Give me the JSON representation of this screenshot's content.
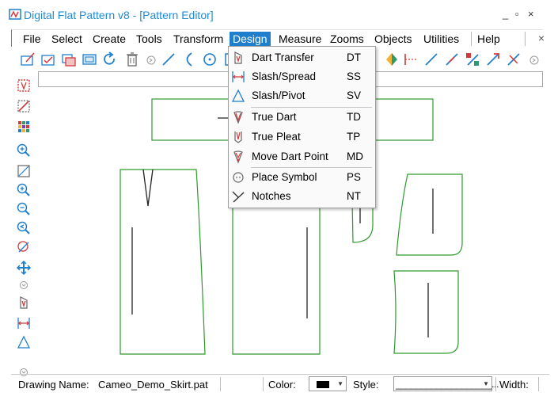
{
  "window": {
    "title": "Digital Flat Pattern v8 - [Pattern Editor]",
    "controls": [
      "_",
      "▫",
      "×"
    ]
  },
  "menubar": {
    "items": [
      "File",
      "Select",
      "Create",
      "Tools",
      "Transform",
      "Design",
      "Measure",
      "Zooms",
      "Objects",
      "Utilities",
      "Help"
    ],
    "active": "Design",
    "close_glyph": "×"
  },
  "design_menu": {
    "items": [
      {
        "label": "Dart Transfer",
        "shortcut": "DT",
        "icon": "dart-transfer-icon"
      },
      {
        "label": "Slash/Spread",
        "shortcut": "SS",
        "icon": "slash-spread-icon"
      },
      {
        "label": "Slash/Pivot",
        "shortcut": "SV",
        "icon": "slash-pivot-icon"
      },
      {
        "label": "True Dart",
        "shortcut": "TD",
        "icon": "true-dart-icon"
      },
      {
        "label": "True Pleat",
        "shortcut": "TP",
        "icon": "true-pleat-icon"
      },
      {
        "label": "Move Dart Point",
        "shortcut": "MD",
        "icon": "move-dart-point-icon"
      },
      {
        "label": "Place Symbol",
        "shortcut": "PS",
        "icon": "place-symbol-icon"
      },
      {
        "label": "Notches",
        "shortcut": "NT",
        "icon": "notches-icon"
      }
    ]
  },
  "statusbar": {
    "drawing_label": "Drawing Name:",
    "drawing_name": "Cameo_Demo_Skirt.pat",
    "color_label": "Color:",
    "color_value": "#000000",
    "style_label": "Style:",
    "style_value": "___________________...",
    "width_label": "Width:"
  },
  "colors": {
    "accent": "#1f7fcc",
    "title": "#1f8bd6",
    "pattern_outline": "#2e9a2e"
  }
}
